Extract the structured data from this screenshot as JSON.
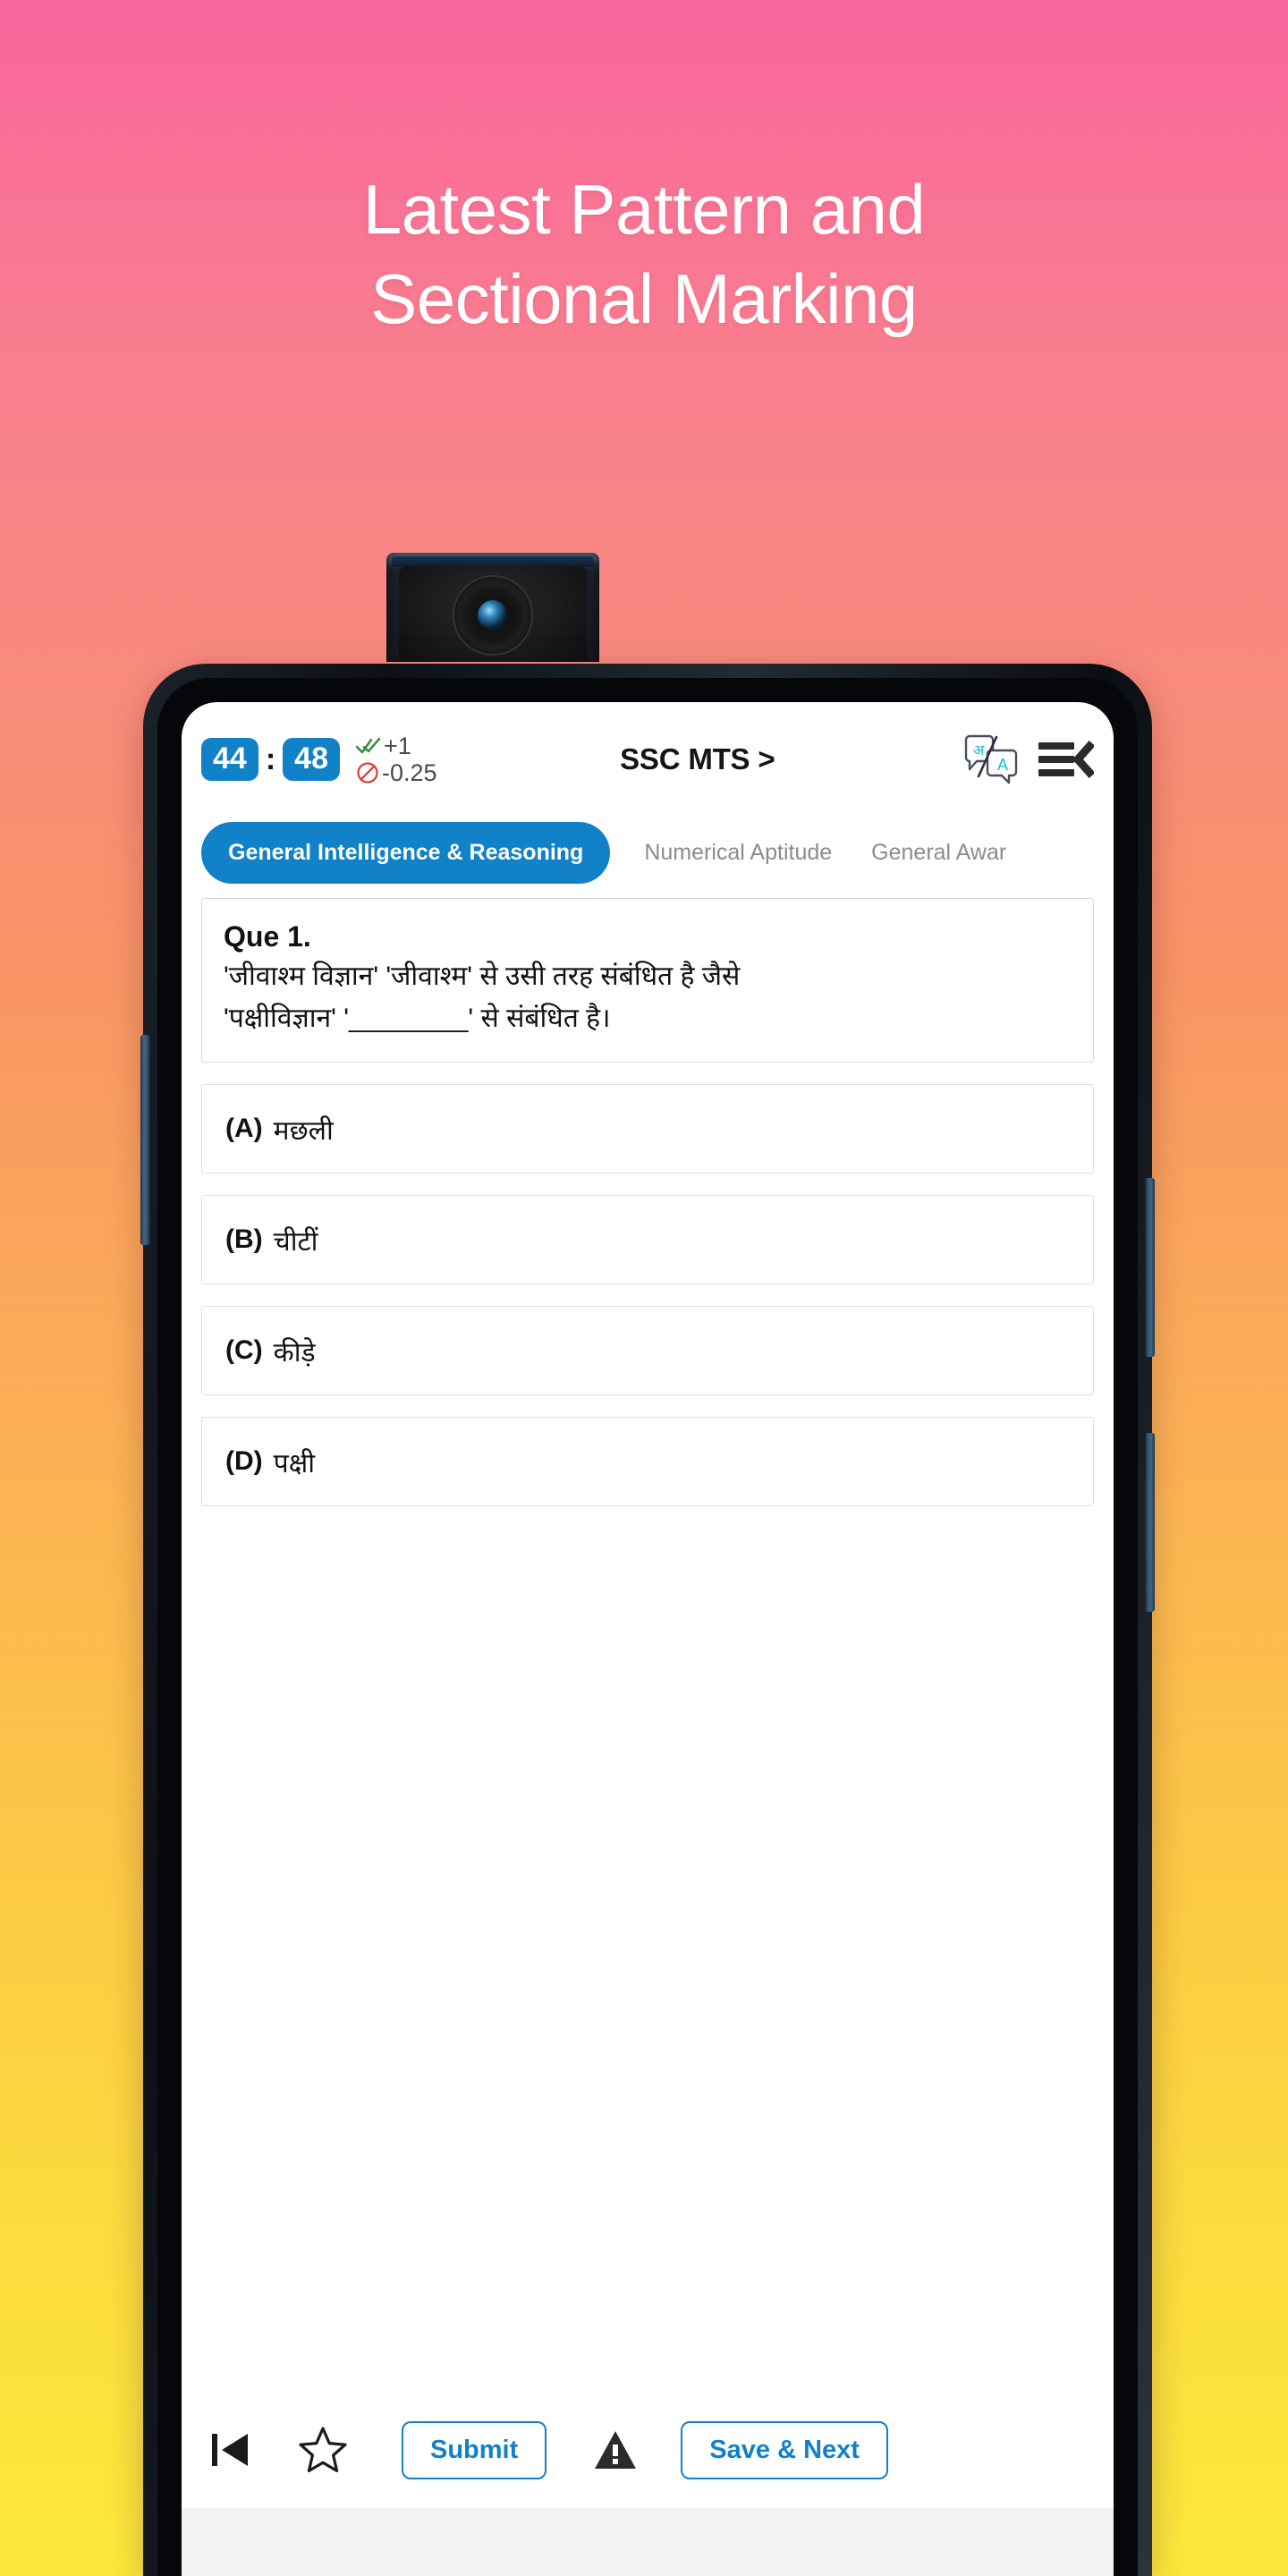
{
  "promo": {
    "headline_line1": "Latest Pattern and",
    "headline_line2": "Sectional Marking"
  },
  "colors": {
    "accent_blue": "#1181C8",
    "gradient_top": "#F9669E",
    "gradient_bottom": "#FCE93B",
    "positive_mark": "#2E8B3D",
    "negative_mark": "#E23B3B"
  },
  "app": {
    "header": {
      "timer_minutes": "44",
      "timer_separator": ":",
      "timer_seconds": "48",
      "positive_marks": "+1",
      "negative_marks": "-0.25",
      "title": "SSC MTS >",
      "translate_icon_left_glyph": "अ",
      "translate_icon_right_glyph": "A"
    },
    "tabs": [
      {
        "label": "General Intelligence & Reasoning",
        "active": true
      },
      {
        "label": "Numerical Aptitude",
        "active": false
      },
      {
        "label": "General Awar",
        "active": false
      }
    ],
    "question": {
      "number_label": "Que 1.",
      "text_line1": "'जीवाश्म विज्ञान' 'जीवाश्म' से उसी तरह संबंधित है जैसे",
      "text_line2": "'पक्षीविज्ञान' '________' से संबंधित है।"
    },
    "options": [
      {
        "letter": "(A)",
        "text": "मछली"
      },
      {
        "letter": "(B)",
        "text": "चीटीं"
      },
      {
        "letter": "(C)",
        "text": "कीड़े"
      },
      {
        "letter": "(D)",
        "text": "पक्षी"
      }
    ],
    "bottom_bar": {
      "submit_label": "Submit",
      "save_next_label": "Save & Next",
      "prev_icon": "previous-question-icon",
      "star_icon": "bookmark-star-icon",
      "warning_icon": "report-warning-icon"
    }
  }
}
